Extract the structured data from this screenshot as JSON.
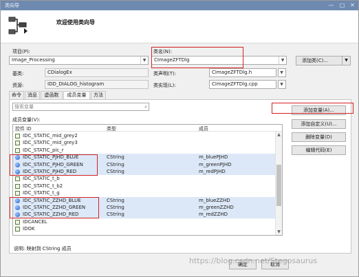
{
  "window": {
    "title": "类向导",
    "minimize": "—",
    "maximize": "□",
    "close": "✕"
  },
  "header": {
    "title": "欢迎使用类向导",
    "icon": "class-wizard-icon"
  },
  "project": {
    "label": "项目(P):",
    "value": "Image_Processing"
  },
  "classname": {
    "label": "类名(N):",
    "value": "CImageZFTDlg"
  },
  "add_class_button": {
    "label": "添加类(C)...",
    "arrow": "▼"
  },
  "base_class": {
    "label": "基类:",
    "value": "CDialogEx"
  },
  "class_decl": {
    "label": "类声明(T):",
    "value": "CImageZFTDlg.h"
  },
  "resource": {
    "label": "资源:",
    "value": "IDD_DIALOG_histogram"
  },
  "class_impl": {
    "label": "类实现(L):",
    "value": "CImageZFTDlg.cpp"
  },
  "tabs": [
    "命令",
    "消息",
    "虚函数",
    "成员变量",
    "方法"
  ],
  "search": {
    "placeholder": "搜索变量",
    "icon": "search-icon"
  },
  "members_label": "成员变量(V):",
  "columns": {
    "id": "控件 ID",
    "type": "类型",
    "member": "成员"
  },
  "rows": [
    {
      "id": "IDC_STATIC_mid_grey2",
      "type": "",
      "member": "",
      "kind": "plain"
    },
    {
      "id": "IDC_STATIC_mid_grey3",
      "type": "",
      "member": "",
      "kind": "plain"
    },
    {
      "id": "IDC_STATIC_pic_r",
      "type": "",
      "member": "",
      "kind": "plain"
    },
    {
      "id": "IDC_STATIC_PJHD_BLUE",
      "type": "CString",
      "member": "m_bluePJHD",
      "kind": "var"
    },
    {
      "id": "IDC_STATIC_PJHD_GREEN",
      "type": "CString",
      "member": "m_greenPJHD",
      "kind": "var"
    },
    {
      "id": "IDC_STATIC_PJHD_RED",
      "type": "CString",
      "member": "m_redPJHD",
      "kind": "var"
    },
    {
      "id": "IDC_STATIC_t_b",
      "type": "",
      "member": "",
      "kind": "plain"
    },
    {
      "id": "IDC_STATIC_t_b2",
      "type": "",
      "member": "",
      "kind": "plain"
    },
    {
      "id": "IDC_STATIC_t_g",
      "type": "",
      "member": "",
      "kind": "plain"
    },
    {
      "id": "IDC_STATIC_ZZHD_BLUE",
      "type": "CString",
      "member": "m_blueZZHD",
      "kind": "var"
    },
    {
      "id": "IDC_STATIC_ZZHD_GREEN",
      "type": "CString",
      "member": "m_greenZZHD",
      "kind": "var"
    },
    {
      "id": "IDC_STATIC_ZZHD_RED",
      "type": "CString",
      "member": "m_redZZHD",
      "kind": "var"
    },
    {
      "id": "IDCANCEL",
      "type": "",
      "member": "",
      "kind": "plain"
    },
    {
      "id": "IDOK",
      "type": "",
      "member": "",
      "kind": "plain"
    }
  ],
  "side_buttons": [
    "添加变量(A)...",
    "添加自定义(U)...",
    "删除变量(D)",
    "编辑代码(E)"
  ],
  "description": "说明:   映射到 CString 成员",
  "footer": {
    "ok": "确定",
    "cancel": "取消"
  },
  "watermark": "https://blog.csdn.net/Stegosaurus",
  "colors": {
    "highlight_box": "#d42020",
    "titlebar": "#6f8ab0",
    "selected_row": "#dce8f7"
  }
}
